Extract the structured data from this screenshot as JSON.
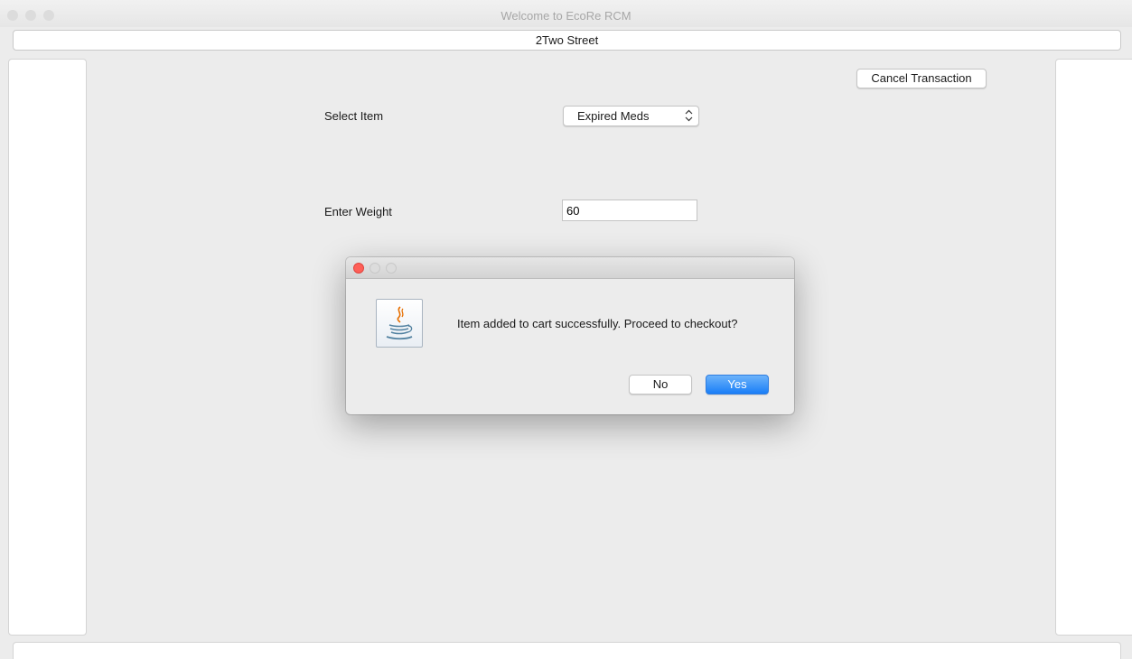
{
  "window": {
    "title": "Welcome to EcoRe RCM"
  },
  "location": {
    "street": "2Two Street"
  },
  "toolbar": {
    "cancel_label": "Cancel Transaction"
  },
  "form": {
    "item_label": "Select Item",
    "item_selected": "Expired Meds",
    "weight_label": "Enter Weight",
    "weight_value": "60"
  },
  "dialog": {
    "message": "Item added to cart successfully. Proceed to checkout?",
    "no_label": "No",
    "yes_label": "Yes",
    "icon": "java-coffee-cup-icon"
  },
  "colors": {
    "primary_button": "#1a7ef7",
    "close_dot": "#fe5f57"
  }
}
